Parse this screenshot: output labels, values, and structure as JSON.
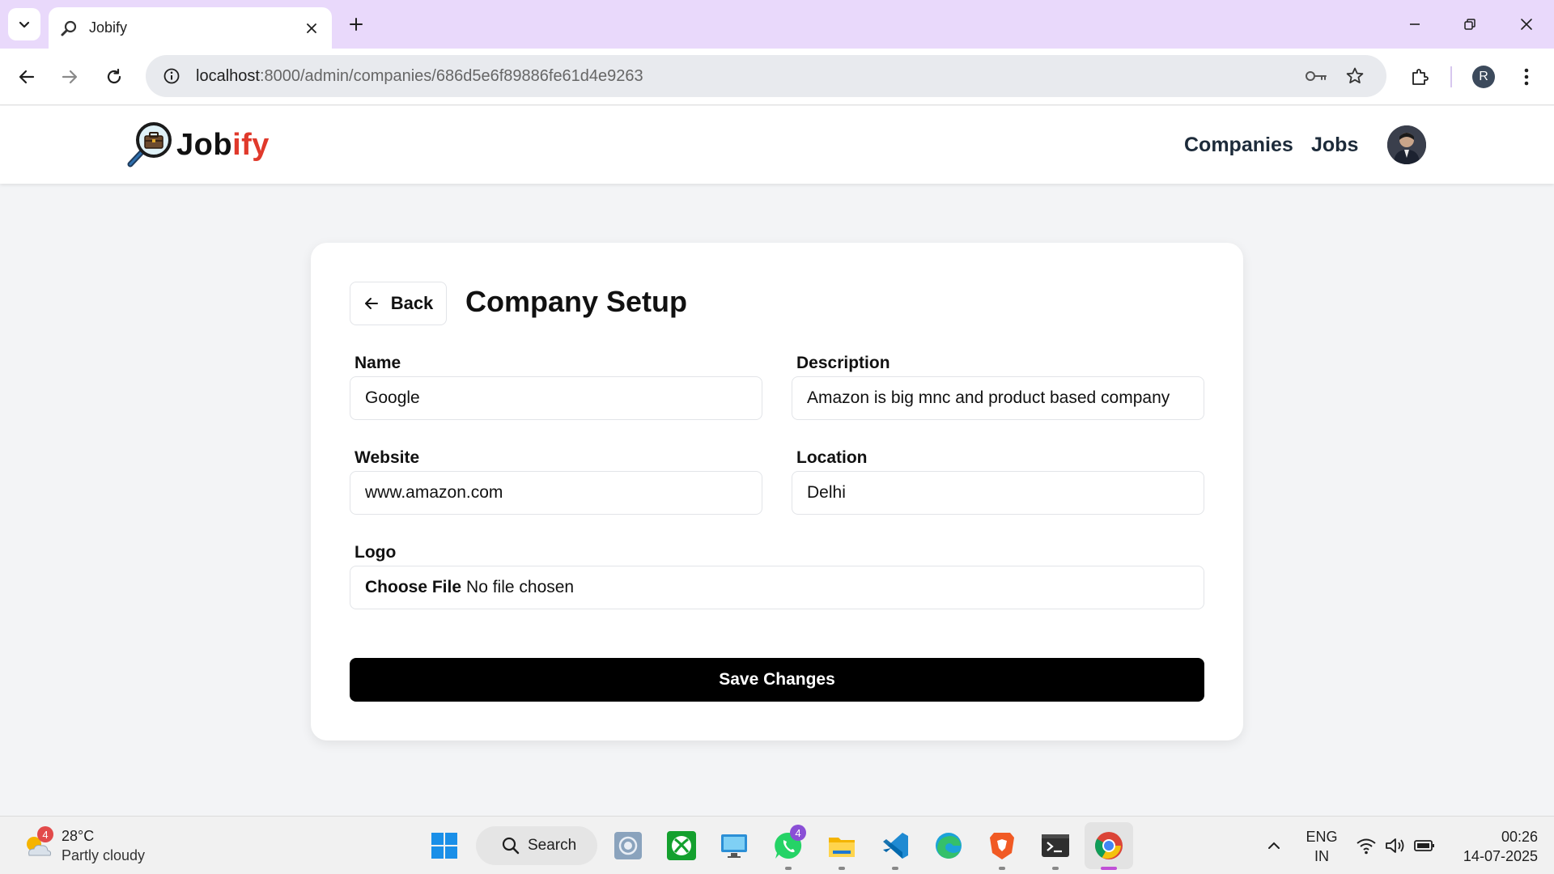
{
  "browser": {
    "tab_title": "Jobify",
    "url_host": "localhost",
    "url_path": ":8000/admin/companies/686d5e6f89886fe61d4e9263",
    "profile_initial": "R"
  },
  "navbar": {
    "brand_part1": "Job",
    "brand_part2": "ify",
    "links": [
      {
        "label": "Companies"
      },
      {
        "label": "Jobs"
      }
    ]
  },
  "page": {
    "back_label": "Back",
    "title": "Company Setup",
    "fields": {
      "name": {
        "label": "Name",
        "value": "Google"
      },
      "description": {
        "label": "Description",
        "value": "Amazon is big mnc and product based company"
      },
      "website": {
        "label": "Website",
        "value": "www.amazon.com"
      },
      "location": {
        "label": "Location",
        "value": "Delhi"
      },
      "logo": {
        "label": "Logo",
        "button": "Choose File",
        "status": "No file chosen"
      }
    },
    "save_label": "Save Changes"
  },
  "taskbar": {
    "weather_badge": "4",
    "temperature": "28°C",
    "condition": "Partly cloudy",
    "search_label": "Search",
    "whatsapp_badge": "4",
    "language": "ENG",
    "region": "IN",
    "time": "00:26",
    "date": "14-07-2025"
  },
  "colors": {
    "tabbar": "#e9d9fb",
    "brand_accent": "#e0392b",
    "save_button": "#000000",
    "page_bg": "#f3f4f6"
  }
}
